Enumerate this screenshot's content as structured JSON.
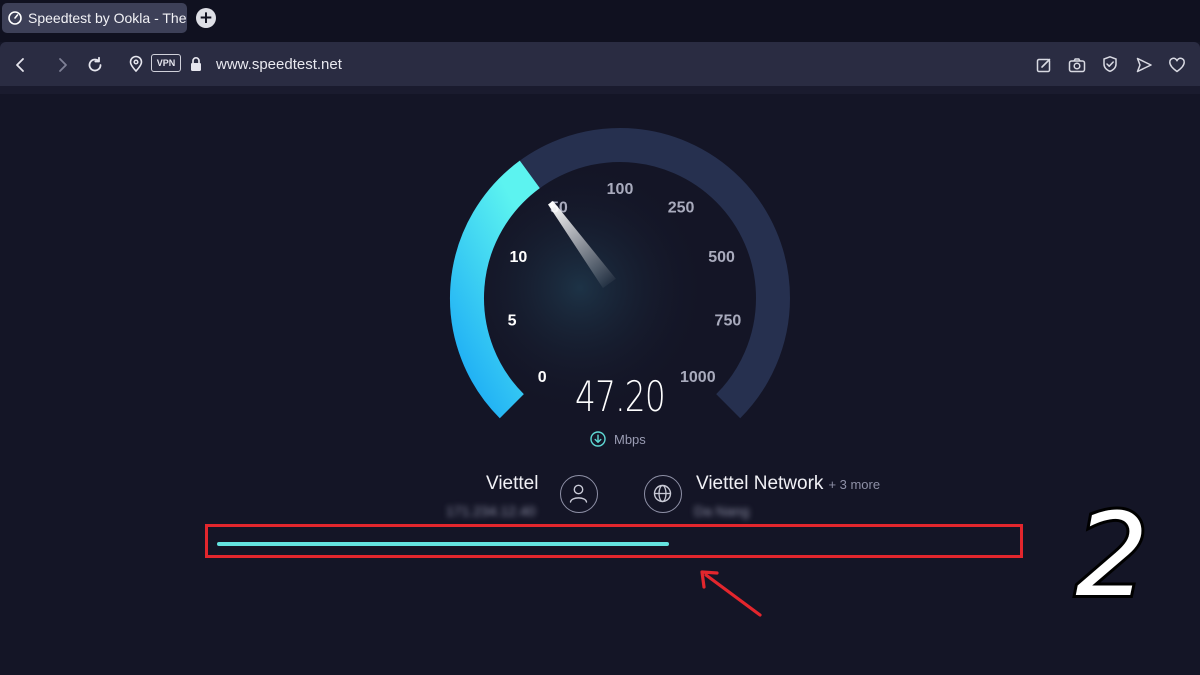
{
  "browser": {
    "tab_title": "Speedtest by Ookla - The",
    "new_tab_symbol": "+",
    "vpn_label": "VPN",
    "url": "www.speedtest.net"
  },
  "gauge": {
    "ticks": [
      "0",
      "5",
      "10",
      "50",
      "100",
      "250",
      "500",
      "750",
      "1000"
    ],
    "speed": "47.20",
    "unit": "Mbps",
    "accent_start": "#1aa9f5",
    "accent_end": "#5cf3f0",
    "track_color": "#26304f"
  },
  "isp": {
    "name": "Viettel",
    "ip": "171.234.12.40"
  },
  "server": {
    "name": "Viettel Network",
    "more": "+ 3 more",
    "location": "Da Nang"
  },
  "progress": {
    "fraction": 0.55,
    "color": "#64e3e0",
    "frame_color": "#e3262d"
  },
  "annotation": {
    "number": "2"
  },
  "icons": [
    "speedtest-favicon",
    "back-icon",
    "forward-icon",
    "reload-icon",
    "location-icon",
    "lock-icon",
    "edit-icon",
    "camera-icon",
    "shield-icon",
    "send-icon",
    "heart-icon",
    "download-icon",
    "user-icon",
    "globe-icon"
  ]
}
